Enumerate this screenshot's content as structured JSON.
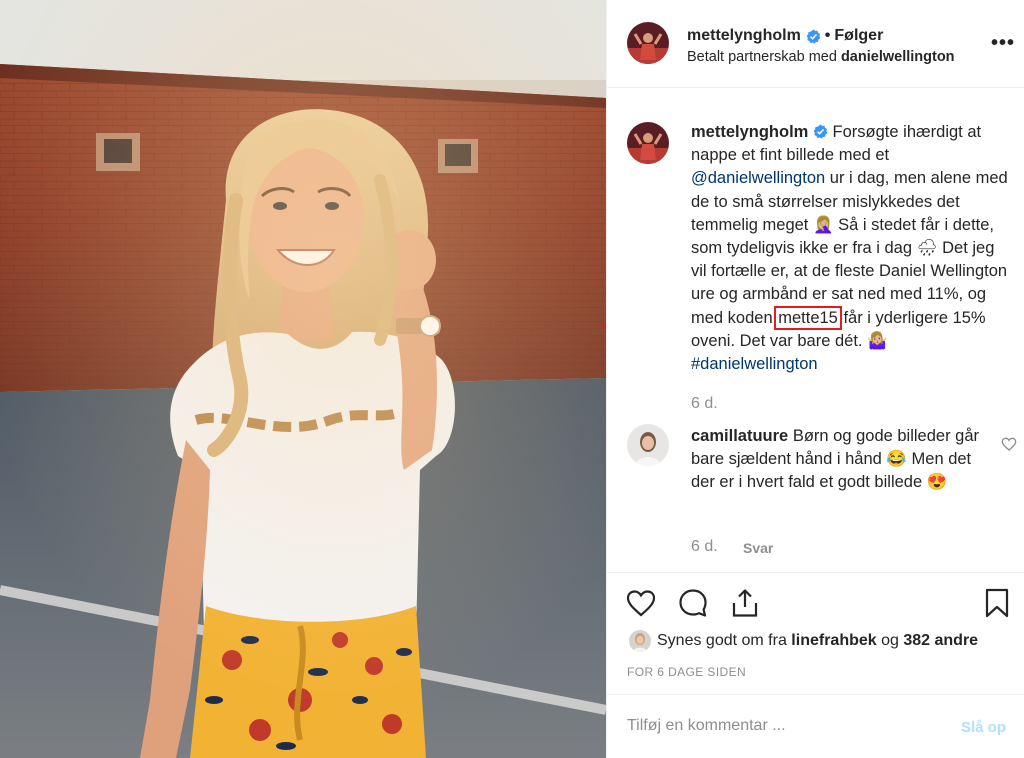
{
  "post": {
    "username": "mettelyngholm",
    "separator": "•",
    "follow_label": "Følger",
    "partnership_prefix": "Betalt partnerskab med",
    "partner": "danielwellington",
    "more_label": "•••"
  },
  "caption": {
    "username": "mettelyngholm",
    "text_1": "Forsøgte ihærdigt at nappe et fint billede med et",
    "mention": "@danielwellington",
    "text_2": "ur i dag, men alene med de to små størrelser mislykkedes det temmelig meget 🤦🏼‍♀️ Så i stedet får i dette, som tydeligvis ikke er fra i dag 🌧 Det jeg vil fortælle er, at de fleste Daniel Wellington ure og armbånd er sat ned med 11%, og med koden",
    "code": "mette15",
    "text_3": "får i yderligere 15% oveni. Det var bare dét. 🤷🏼‍♀️",
    "hashtag": "#danielwellington",
    "time": "6 d."
  },
  "comment": {
    "username": "camillatuure",
    "text": "Børn og gode billeder går bare sjældent hånd i hånd 😂 Men det der er i hvert fald et godt billede 😍",
    "time": "6 d.",
    "reply_label": "Svar"
  },
  "likes": {
    "prefix": "Synes godt om fra",
    "user": "linefrahbek",
    "middle": "og",
    "count_label": "382 andre"
  },
  "timestamp": "FOR 6 DAGE SIDEN",
  "add_comment": {
    "placeholder": "Tilføj en kommentar ...",
    "post_label": "Slå op"
  },
  "colors": {
    "verified": "#3897f0",
    "link": "#00376b",
    "annotation": "#e01e1e",
    "post_disabled": "#b2dffc"
  },
  "icons": {
    "like": "heart-icon",
    "comment": "comment-bubble-icon",
    "share": "share-icon",
    "save": "bookmark-icon"
  }
}
